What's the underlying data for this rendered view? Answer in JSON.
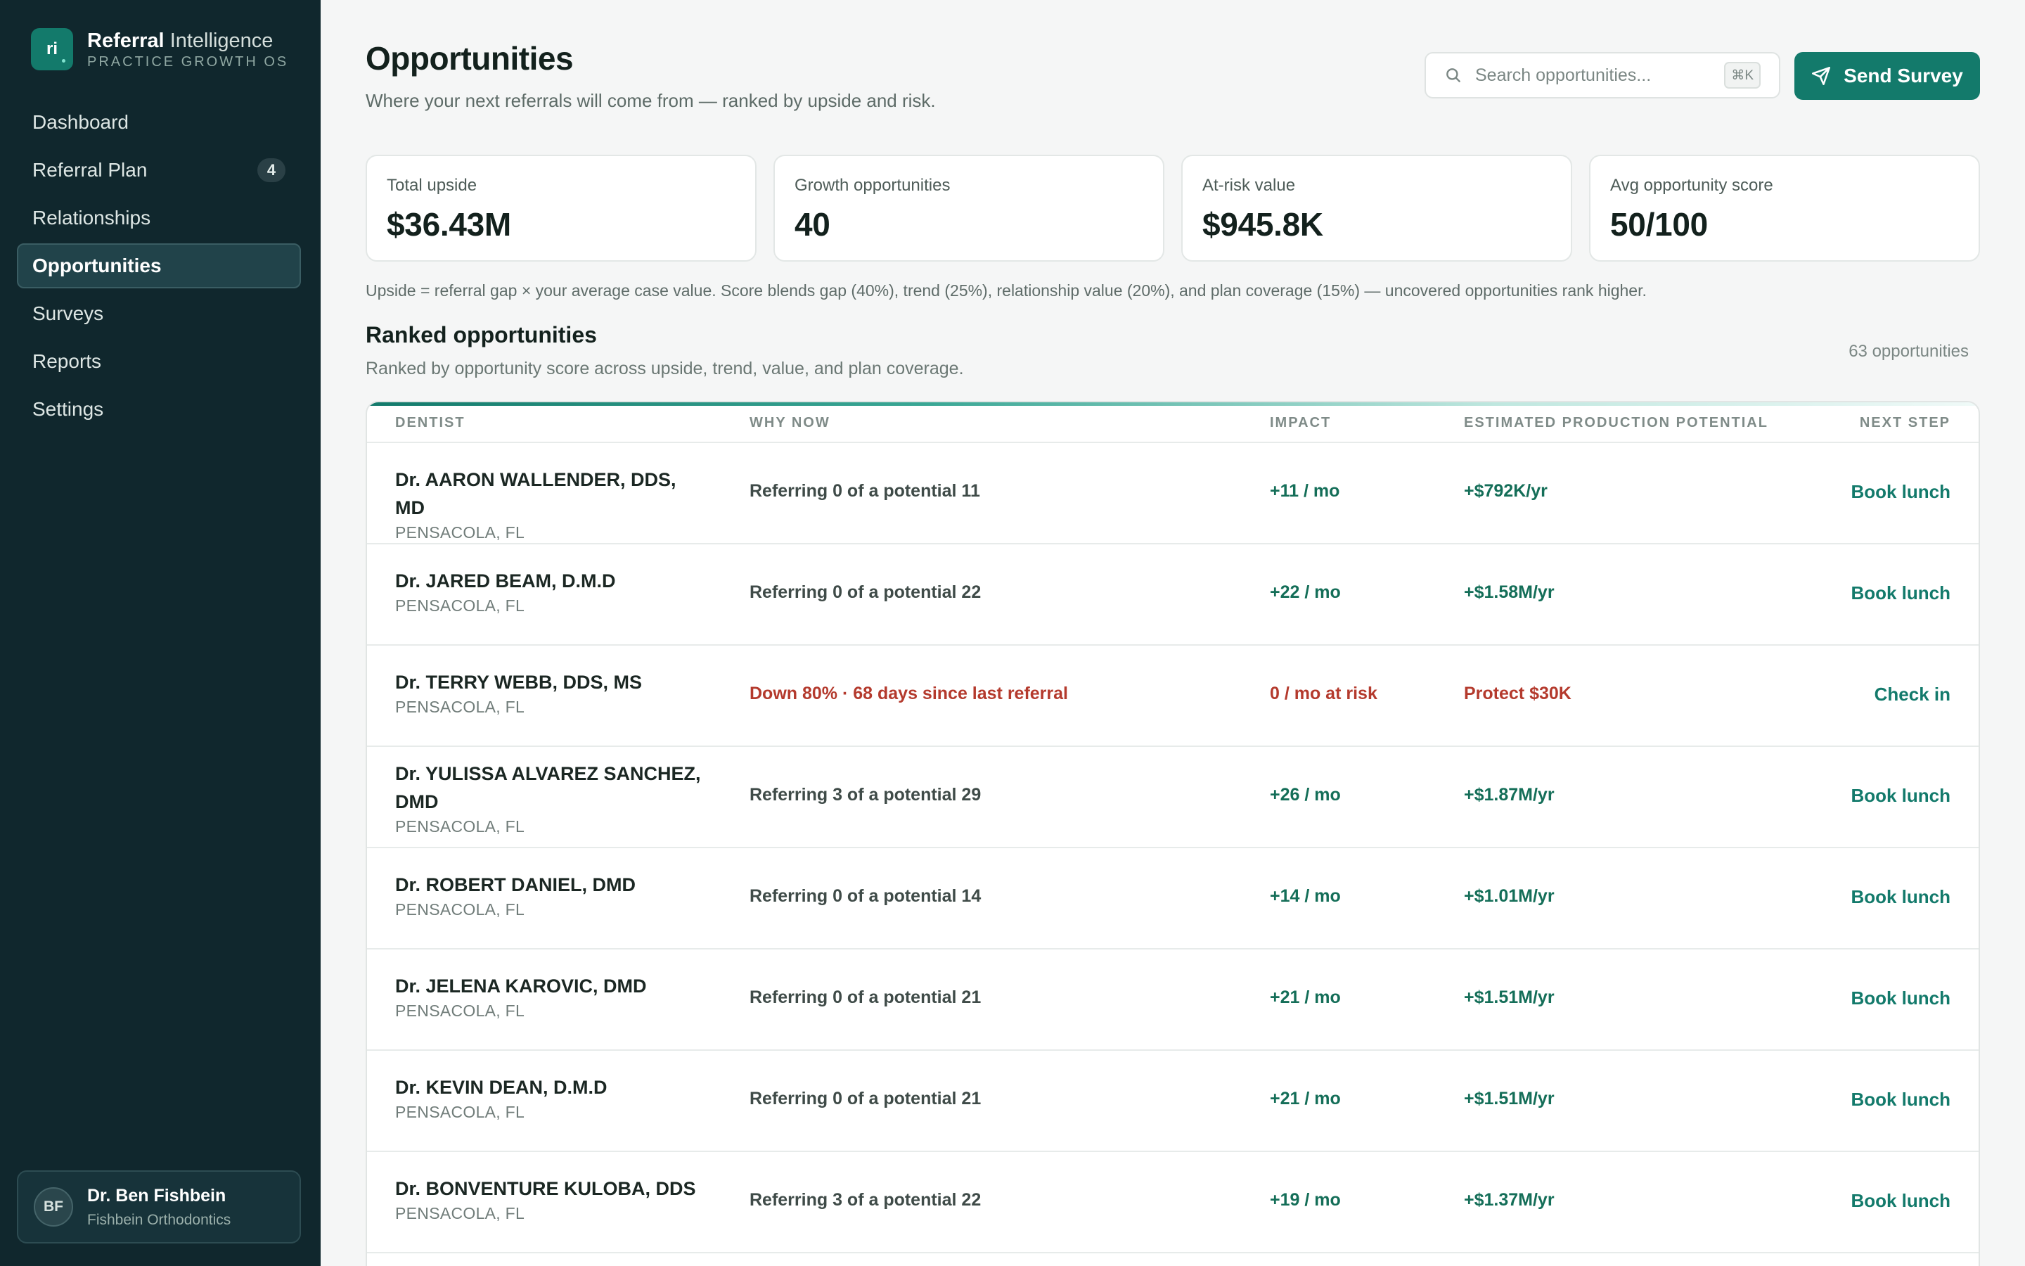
{
  "brand": {
    "logo": "ri",
    "name_bold": "Referral",
    "name_rest": "Intelligence",
    "tagline": "PRACTICE GROWTH OS"
  },
  "nav": {
    "items": [
      {
        "label": "Dashboard",
        "badge": ""
      },
      {
        "label": "Referral Plan",
        "badge": "4"
      },
      {
        "label": "Relationships",
        "badge": ""
      },
      {
        "label": "Opportunities",
        "badge": "",
        "active": true
      },
      {
        "label": "Surveys",
        "badge": ""
      },
      {
        "label": "Reports",
        "badge": ""
      },
      {
        "label": "Settings",
        "badge": ""
      }
    ]
  },
  "user": {
    "initials": "BF",
    "name": "Dr. Ben Fishbein",
    "org": "Fishbein Orthodontics"
  },
  "header": {
    "title": "Opportunities",
    "subtitle": "Where your next referrals will come from — ranked by upside and risk.",
    "search_placeholder": "Search opportunities...",
    "search_shortcut": "⌘K",
    "send_label": "Send Survey"
  },
  "stats": [
    {
      "label": "Total upside",
      "value": "$36.43M"
    },
    {
      "label": "Growth opportunities",
      "value": "40"
    },
    {
      "label": "At-risk value",
      "value": "$945.8K"
    },
    {
      "label": "Avg opportunity score",
      "value": "50/100"
    }
  ],
  "formula_note": "Upside = referral gap × your average case value. Score blends gap (40%), trend (25%), relationship value (20%), and plan coverage (15%) — uncovered opportunities rank higher.",
  "ranked": {
    "title": "Ranked opportunities",
    "subtitle": "Ranked by opportunity score across upside, trend, value, and plan coverage.",
    "count": "63 opportunities",
    "columns": [
      "DENTIST",
      "WHY NOW",
      "IMPACT",
      "ESTIMATED PRODUCTION POTENTIAL",
      "NEXT STEP"
    ],
    "rows": [
      {
        "name": "Dr. AARON WALLENDER, DDS, MD",
        "location": "PENSACOLA, FL",
        "why": "Referring 0 of a potential 11",
        "impact": "+11 / mo",
        "potential": "+$792K/yr",
        "next": "Book lunch",
        "risk": false
      },
      {
        "name": "Dr. JARED BEAM, D.M.D",
        "location": "PENSACOLA, FL",
        "why": "Referring 0 of a potential 22",
        "impact": "+22 / mo",
        "potential": "+$1.58M/yr",
        "next": "Book lunch",
        "risk": false
      },
      {
        "name": "Dr. TERRY WEBB, DDS, MS",
        "location": "PENSACOLA, FL",
        "why": "Down 80% · 68 days since last referral",
        "impact": "0 / mo at risk",
        "potential": "Protect $30K",
        "next": "Check in",
        "risk": true
      },
      {
        "name": "Dr. YULISSA ALVAREZ SANCHEZ, DMD",
        "location": "PENSACOLA, FL",
        "why": "Referring 3 of a potential 29",
        "impact": "+26 / mo",
        "potential": "+$1.87M/yr",
        "next": "Book lunch",
        "risk": false
      },
      {
        "name": "Dr. ROBERT DANIEL, DMD",
        "location": "PENSACOLA, FL",
        "why": "Referring 0 of a potential 14",
        "impact": "+14 / mo",
        "potential": "+$1.01M/yr",
        "next": "Book lunch",
        "risk": false
      },
      {
        "name": "Dr. JELENA KAROVIC, DMD",
        "location": "PENSACOLA, FL",
        "why": "Referring 0 of a potential 21",
        "impact": "+21 / mo",
        "potential": "+$1.51M/yr",
        "next": "Book lunch",
        "risk": false
      },
      {
        "name": "Dr. KEVIN DEAN, D.M.D",
        "location": "PENSACOLA, FL",
        "why": "Referring 0 of a potential 21",
        "impact": "+21 / mo",
        "potential": "+$1.51M/yr",
        "next": "Book lunch",
        "risk": false
      },
      {
        "name": "Dr. BONVENTURE KULOBA, DDS",
        "location": "PENSACOLA, FL",
        "why": "Referring 3 of a potential 22",
        "impact": "+19 / mo",
        "potential": "+$1.37M/yr",
        "next": "Book lunch",
        "risk": false
      }
    ]
  }
}
